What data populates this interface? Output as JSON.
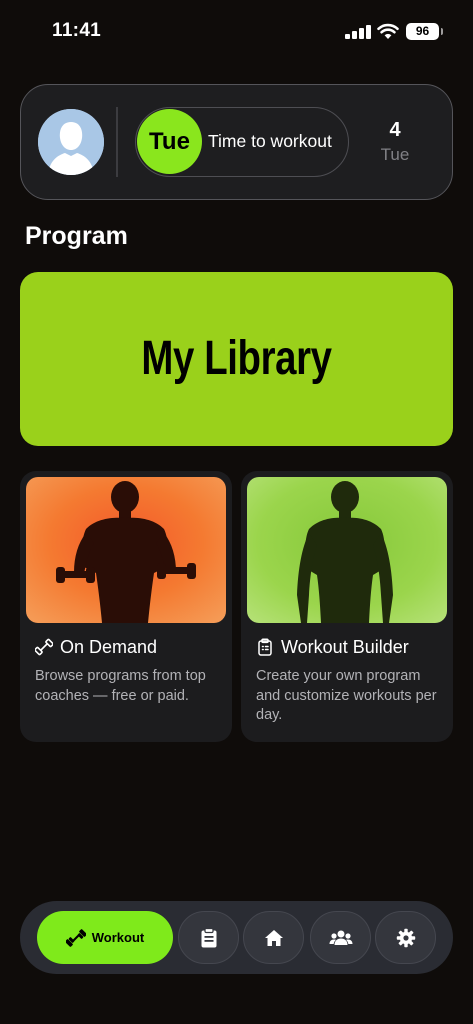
{
  "status_bar": {
    "time": "11:41",
    "battery": "96"
  },
  "header": {
    "day_badge": "Tue",
    "day_text": "Time to workout",
    "date_number": "4",
    "date_day": "Tue"
  },
  "section_title": "Program",
  "library": {
    "title": "My Library"
  },
  "cards": [
    {
      "title": "On Demand",
      "icon": "dumbbell-icon",
      "description": "Browse programs from top coaches — free or paid.",
      "image_color": "#f57a2b"
    },
    {
      "title": "Workout Builder",
      "icon": "clipboard-icon",
      "description": "Create your own program and customize workouts per day.",
      "image_color": "#9ad63a"
    }
  ],
  "nav": {
    "active_label": "Workout",
    "items": [
      "dumbbell-icon",
      "clipboard-icon",
      "home-icon",
      "group-icon",
      "gear-icon"
    ]
  },
  "colors": {
    "accent": "#8ae61d",
    "library_bg": "#9ad11b",
    "background": "#0f0c0a"
  }
}
